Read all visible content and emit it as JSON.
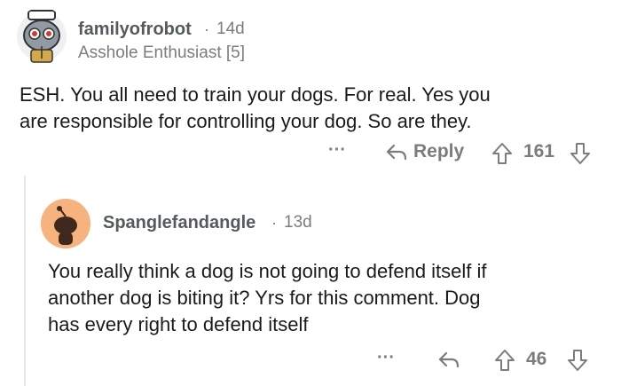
{
  "comment1": {
    "username": "familyofrobot",
    "separator": "·",
    "age": "14d",
    "flair": "Asshole Enthusiast [5]",
    "body_lines": [
      "ESH. You all need to train your dogs. For real. Yes you",
      "are responsible for controlling your dog. So are they."
    ],
    "more_label": "···",
    "reply_label": "Reply",
    "score": "161"
  },
  "comment2": {
    "username": "Spanglefandangle",
    "separator": "·",
    "age": "13d",
    "body_lines": [
      "You really think a dog is not going to defend itself if",
      "another dog is biting it? Yrs for this comment. Dog",
      "has every right to defend itself"
    ],
    "more_label": "···",
    "score": "46"
  },
  "colors": {
    "text": "#1a1a1b",
    "muted": "#7c7c7c",
    "thread_line": "#e6e6e6",
    "avatar2_bg": "#f7b37d"
  }
}
